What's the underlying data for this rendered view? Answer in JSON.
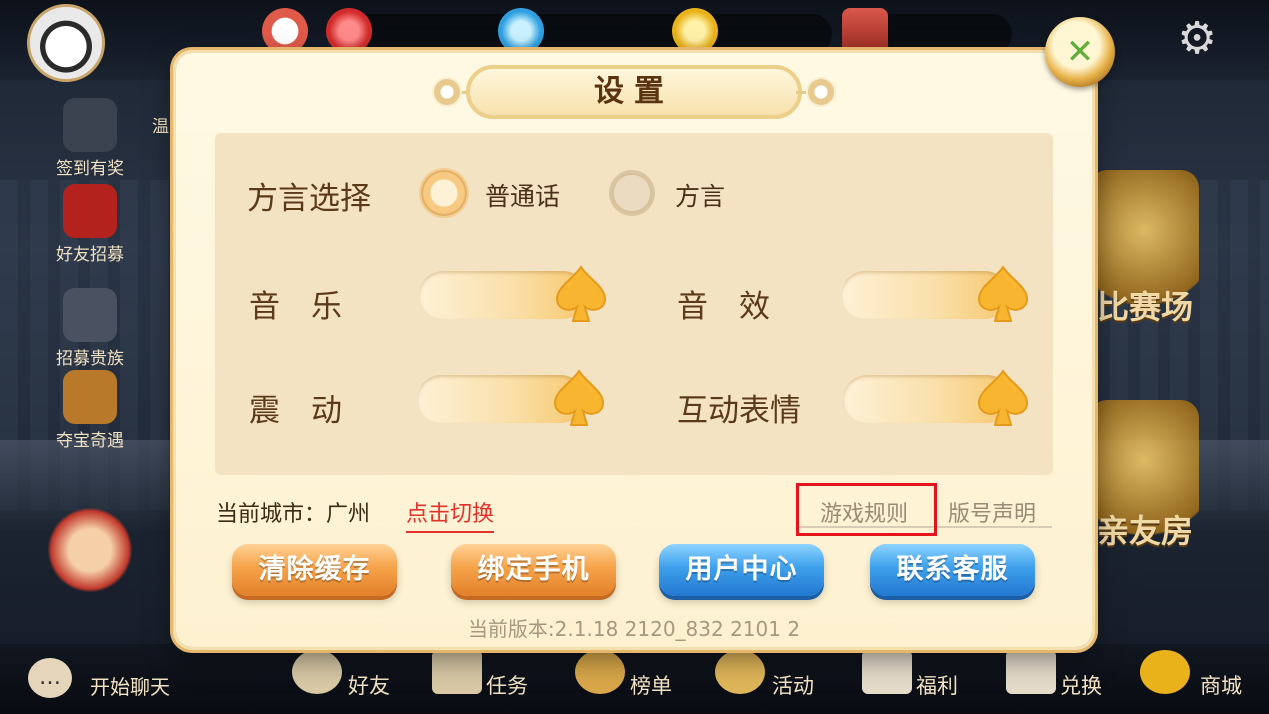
{
  "background": {
    "left_menu": [
      "签到有奖",
      "好友招募",
      "招募贵族",
      "夺宝奇遇"
    ],
    "partial_left_text": "温",
    "right_labels": [
      "比赛场",
      "亲友房"
    ],
    "bottom_bar": {
      "chat": "开始聊天",
      "items": [
        "好友",
        "任务",
        "榜单",
        "活动",
        "福利",
        "兑换",
        "商城"
      ]
    }
  },
  "dialog": {
    "title": "设置",
    "dialect": {
      "label": "方言选择",
      "options": [
        {
          "label": "普通话",
          "selected": true
        },
        {
          "label": "方言",
          "selected": false
        }
      ]
    },
    "sliders": [
      {
        "label": "音　乐",
        "value_percent": 100
      },
      {
        "label": "音　效",
        "value_percent": 100
      },
      {
        "label": "震　动",
        "value_percent": 100
      },
      {
        "label": "互动表情",
        "value_percent": 100
      }
    ],
    "city": {
      "label": "当前城市：广州",
      "switch_link": "点击切换"
    },
    "links": {
      "rules": "游戏规则",
      "copyright": "版号声明"
    },
    "buttons": {
      "clear_cache": "清除缓存",
      "bind_phone": "绑定手机",
      "user_center": "用户中心",
      "contact_service": "联系客服"
    },
    "version": "当前版本:2.1.18 2120_832 2101 2"
  },
  "colors": {
    "accent_red": "#e4322b",
    "title_brown": "#5a3411",
    "button_orange": "#f6a34a",
    "button_blue": "#3ea0ec",
    "highlight_box": "#e3141b"
  }
}
